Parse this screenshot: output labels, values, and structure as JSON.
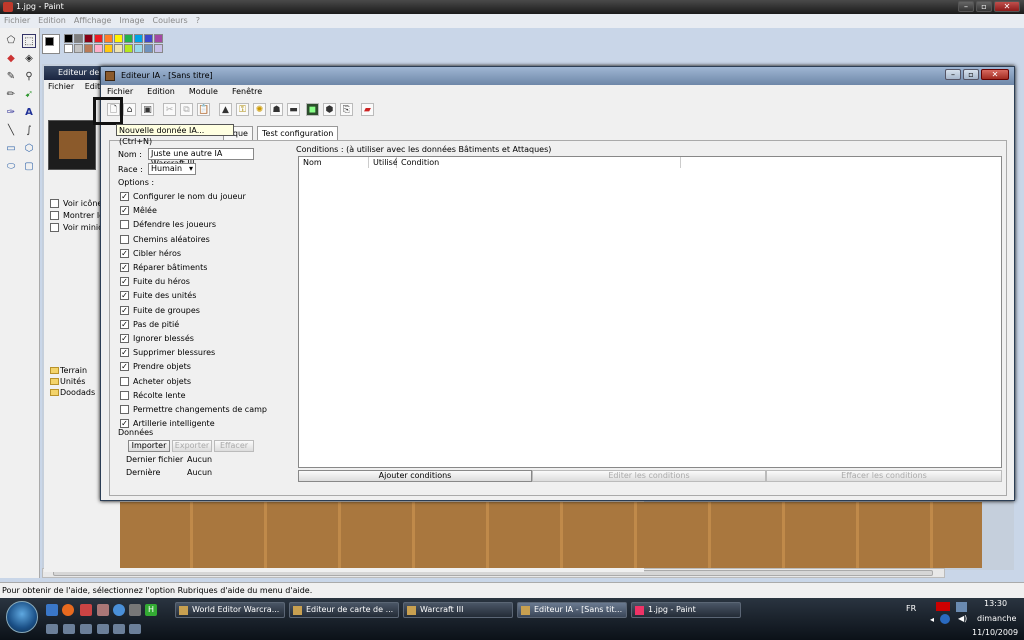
{
  "paint": {
    "title": "1.jpg - Paint",
    "menu": [
      "Fichier",
      "Edition",
      "Affichage",
      "Image",
      "Couleurs",
      "?"
    ],
    "status": "Pour obtenir de l'aide, sélectionnez l'option Rubriques d'aide du menu d'aide.",
    "palette": [
      "#000000",
      "#7f7f7f",
      "#880015",
      "#ed1c24",
      "#ff7f27",
      "#fff200",
      "#22b14c",
      "#00a2e8",
      "#3f48cc",
      "#a349a4",
      "#ffffff",
      "#c3c3c3",
      "#b97a57",
      "#ffaec9",
      "#ffc90e",
      "#efe4b0",
      "#b5e61d",
      "#99d9ea",
      "#7092be",
      "#c8bfe7"
    ]
  },
  "background_editor": {
    "title": "Editeur de",
    "menu": [
      "Fichier",
      "Edit"
    ],
    "options": [
      "Voir icônes",
      "Montrer les",
      "Voir minica"
    ],
    "tree": [
      "Terrain",
      "Unités",
      "Doodads"
    ]
  },
  "ia_editor": {
    "title": "Editeur IA - [Sans titre]",
    "menu": [
      "Fichier",
      "Edition",
      "Module",
      "Fenêtre"
    ],
    "tooltip": "Nouvelle donnée IA... (Ctrl+N)",
    "tabs": [
      "aque",
      "Test configuration"
    ],
    "name_label": "Nom :",
    "name_value": "Juste une autre IA Warcraft III",
    "race_label": "Race :",
    "race_value": "Humain",
    "options_label": "Options :",
    "options": [
      {
        "label": "Configurer le nom du joueur",
        "checked": true
      },
      {
        "label": "Mêlée",
        "checked": true
      },
      {
        "label": "Défendre les joueurs",
        "checked": false
      },
      {
        "label": "Chemins aléatoires",
        "checked": false
      },
      {
        "label": "Cibler héros",
        "checked": true
      },
      {
        "label": "Réparer bâtiments",
        "checked": true
      },
      {
        "label": "Fuite du héros",
        "checked": true
      },
      {
        "label": "Fuite des unités",
        "checked": true
      },
      {
        "label": "Fuite de groupes",
        "checked": true
      },
      {
        "label": "Pas de pitié",
        "checked": true
      },
      {
        "label": "Ignorer blessés",
        "checked": true
      },
      {
        "label": "Supprimer blessures",
        "checked": true
      },
      {
        "label": "Prendre objets",
        "checked": true
      },
      {
        "label": "Acheter objets",
        "checked": false
      },
      {
        "label": "Récolte lente",
        "checked": false
      },
      {
        "label": "Permettre changements de camp",
        "checked": false
      },
      {
        "label": "Artillerie intelligente",
        "checked": true
      }
    ],
    "data_label": "Données",
    "import_btn": "Importer",
    "export_btn": "Exporter",
    "clear_btn": "Effacer",
    "last_file_label": "Dernier fichier",
    "last_file_value": "Aucun",
    "last_label": "Dernière",
    "last_value": "Aucun",
    "conditions_title": "Conditions : (à utiliser avec les données Bâtiments et Attaques)",
    "columns": [
      "Nom",
      "Utilisé",
      "Condition"
    ],
    "add_cond": "Ajouter conditions",
    "edit_cond": "Editer les conditions",
    "clear_cond": "Effacer les conditions"
  },
  "taskbar": {
    "items": [
      "World Editor Warcra...",
      "Editeur de carte de ...",
      "Warcraft III",
      "Editeur IA - [Sans tit...",
      "1.jpg - Paint"
    ],
    "lang": "FR",
    "time": "13:30",
    "day": "dimanche",
    "date": "11/10/2009"
  }
}
